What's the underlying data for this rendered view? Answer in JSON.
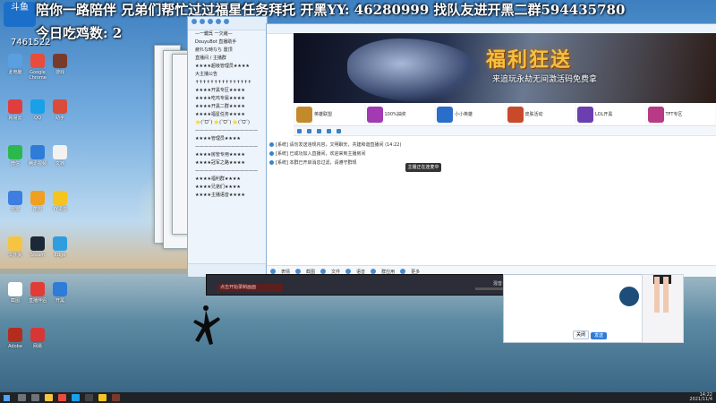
{
  "overlay": {
    "line1": "陪你一路陪伴   兄弟们帮忙过过福星任务拜托   开黑YY: 46280999   找队友进开黑二群594435780",
    "line2": "今日吃鸡数: 2",
    "logo_text": "斗鱼",
    "room_id": "7461522"
  },
  "desktop": {
    "icons": [
      {
        "name": "此电脑",
        "color": "#5aa0e0"
      },
      {
        "name": "Google Chrome",
        "color": "#e84c3d"
      },
      {
        "name": "游戏",
        "color": "#7a3a2a"
      },
      {
        "name": "网易云",
        "color": "#e03e3e"
      },
      {
        "name": "QQ",
        "color": "#18a0e8"
      },
      {
        "name": "助手",
        "color": "#d94c3a"
      },
      {
        "name": "微信",
        "color": "#2ab84f"
      },
      {
        "name": "腾讯视频",
        "color": "#2f7cd8"
      },
      {
        "name": "文档",
        "color": "#f2f2f2"
      },
      {
        "name": "迅雷",
        "color": "#3d7ee0"
      },
      {
        "name": "酷狗",
        "color": "#f0a020"
      },
      {
        "name": "YY语音",
        "color": "#f6c421"
      },
      {
        "name": "文件夹",
        "color": "#f5c542"
      },
      {
        "name": "Steam",
        "color": "#1b2838"
      },
      {
        "name": "Edge",
        "color": "#2f9de0"
      },
      {
        "name": "截图",
        "color": "#ffffff"
      },
      {
        "name": "直播伴侣",
        "color": "#e33c36"
      },
      {
        "name": "开黑",
        "color": "#2f7cd8"
      },
      {
        "name": "Adobe",
        "color": "#b32d1e"
      },
      {
        "name": "网易",
        "color": "#d53737"
      }
    ]
  },
  "qq": {
    "title": "QQ",
    "rows": [
      "—一鍵呉 一欠緒—",
      "DouyuBot 直播助手",
      "疲れな時なち 置顶",
      "直播间 / 主播群",
      "★★★★超级管理员★★★★",
      "大主播公告",
      "✝✝✝✝✝✝✝✝✝✝✝✝✝✝✝",
      "★★★★开黑专区★★★★",
      "★★★★吃鸡专属★★★★",
      "★★★★开黑二群★★★★",
      "★★★★福星任务★★★★",
      "⭐(˘ᗜ˘)  ⭐(˘ᗜ˘)  ⭐(˘ᗜ˘)",
      "——————————————",
      "★★★★管理员★★★★",
      "——————————————",
      "★★★★房管专用★★★★",
      "★★★★冠军之路★★★★",
      "——————————————",
      "★★★★福利群★★★★",
      "★★★★兄弟们★★★★",
      "★★★★主播语音★★★★"
    ]
  },
  "banner": {
    "title": "福利狂送",
    "subtitle": "来追玩永劫无间激活码免费拿"
  },
  "games": [
    {
      "name": "英雄联盟",
      "color": "#c38a2b"
    },
    {
      "name": "100%抽奖",
      "color": "#a23ab2"
    },
    {
      "name": "小小英雄",
      "color": "#2a6ec9"
    },
    {
      "name": "皮肤活动",
      "color": "#c9492b"
    },
    {
      "name": "LOL开黑",
      "color": "#6b3fb0"
    },
    {
      "name": "TFT专区",
      "color": "#b83a84"
    }
  ],
  "messages": [
    "[系统] 请勿发送违规内容，文明聊天，共建和谐直播间 (14:22)",
    "[系统] 已成功加入直播间，欢迎来到主播房间",
    "[系统] 本群已开启消息过滤，请遵守群规"
  ],
  "toast": "主播正在连麦中",
  "chat_toolbar": [
    "表情",
    "截图",
    "文件",
    "语音",
    "群应用",
    "更多"
  ],
  "obs": {
    "source_label": "点击开始录制画面",
    "label1": "混音",
    "label2": "场景"
  },
  "qq2": {
    "send": "发送",
    "close": "关闭"
  },
  "tray": {
    "time": "14:22",
    "date": "2021/11/4"
  }
}
